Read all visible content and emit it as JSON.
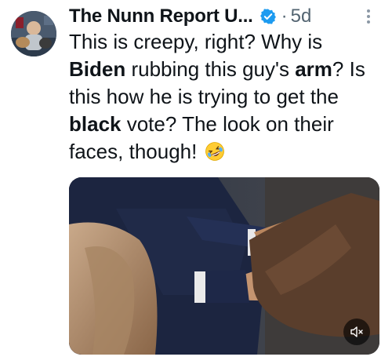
{
  "tweet": {
    "author": {
      "display_name": "The Nunn Report U...",
      "verified_icon": "verified-badge-icon",
      "avatar_icon": "avatar"
    },
    "separator": "·",
    "timestamp": "5d",
    "more_icon": "more-vertical-icon",
    "text": {
      "line1": "This is creepy, right? Why is",
      "line2_bold1": "Biden",
      "line2_mid": " rubbing this guy's ",
      "line2_bold2": "arm",
      "line2_end": "? Is",
      "line3": "this how he is trying to get the",
      "line4_bold": "black",
      "line4_end": " vote? The look on their",
      "line5": "faces, though!",
      "emoji": "rolling-on-floor-laughing-emoji"
    },
    "media": {
      "type": "video",
      "mute_icon": "muted-speaker-icon"
    }
  },
  "colors": {
    "text": "#0f1419",
    "secondary": "#536471",
    "verified": "#1d9bf0"
  }
}
